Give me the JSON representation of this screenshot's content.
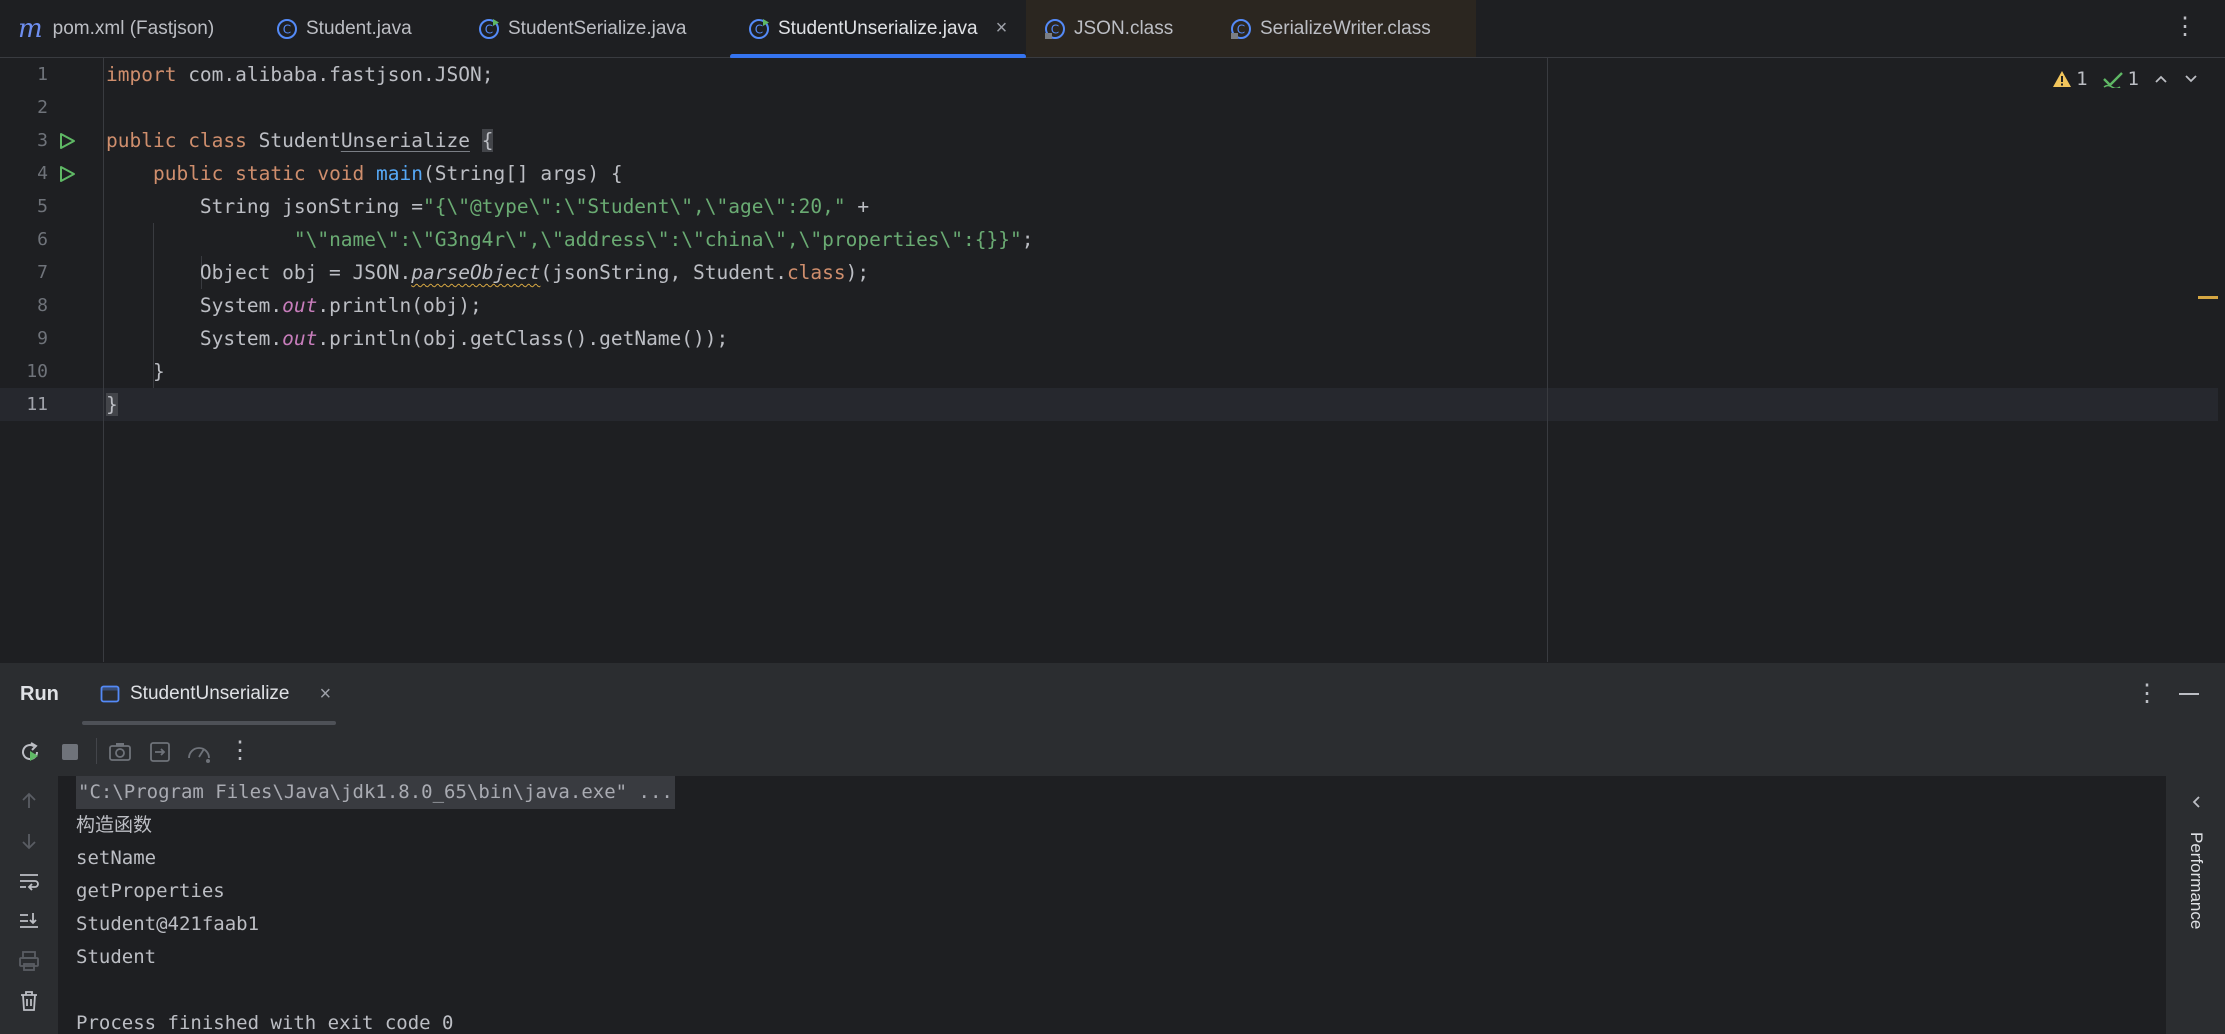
{
  "tabs": [
    {
      "label": "pom.xml (Fastjson)",
      "icon": "maven-icon"
    },
    {
      "label": "Student.java",
      "icon": "class-icon"
    },
    {
      "label": "StudentSerialize.java",
      "icon": "runnable-class-icon"
    },
    {
      "label": "StudentUnserialize.java",
      "icon": "runnable-class-icon",
      "active": true,
      "close": "×"
    },
    {
      "label": "JSON.class",
      "icon": "compiled-class-icon"
    },
    {
      "label": "SerializeWriter.class",
      "icon": "compiled-class-icon"
    }
  ],
  "tab_menu": "⋮",
  "inspections": {
    "warnings": "1",
    "ok": "1"
  },
  "editor": {
    "line_numbers": [
      "1",
      "2",
      "3",
      "4",
      "5",
      "6",
      "7",
      "8",
      "9",
      "10",
      "11"
    ],
    "l1_import": "import",
    "l1_pkg": " com.alibaba.fastjson.JSON;",
    "l3_public": "public",
    "l3_class": " class",
    "l3_name_a": " Student",
    "l3_name_b": "Unserialize",
    "l3_brace": "{",
    "l4_mods": "public static void",
    "l4_main": "main",
    "l4_args": "(String[] args) {",
    "l5_decl": "String jsonString =",
    "l5_str": "\"{\\\"@type\\\":\\\"Student\\\",\\\"age\\\":20,\"",
    "l5_plus": " +",
    "l6_str": "\"\\\"name\\\":\\\"G3ng4r\\\",\\\"address\\\":\\\"china\\\",\\\"properties\\\":{}}\"",
    "l6_semi": ";",
    "l7_a": "Object obj = JSON.",
    "l7_method": "parseObject",
    "l7_b": "(jsonString, Student.",
    "l7_class": "class",
    "l7_c": ");",
    "l8_a": "System.",
    "l8_out": "out",
    "l8_b": ".println(obj);",
    "l9_a": "System.",
    "l9_out": "out",
    "l9_b": ".println(obj.getClass().getName());",
    "l10": "}",
    "l11": "}"
  },
  "run_panel": {
    "title": "Run",
    "tab_label": "StudentUnserialize",
    "tab_close": "×",
    "menu": "⋮",
    "console_lines": [
      "\"C:\\Program Files\\Java\\jdk1.8.0_65\\bin\\java.exe\" ...",
      "构造函数",
      "setName",
      "getProperties",
      "Student@421faab1",
      "Student",
      "",
      "Process finished with exit code 0"
    ],
    "side_label": "Performance"
  },
  "colors": {
    "accent": "#3574f0",
    "keyword": "#cf8e6d",
    "string": "#6aab73",
    "function": "#56a8f5",
    "field": "#c77dbb"
  }
}
